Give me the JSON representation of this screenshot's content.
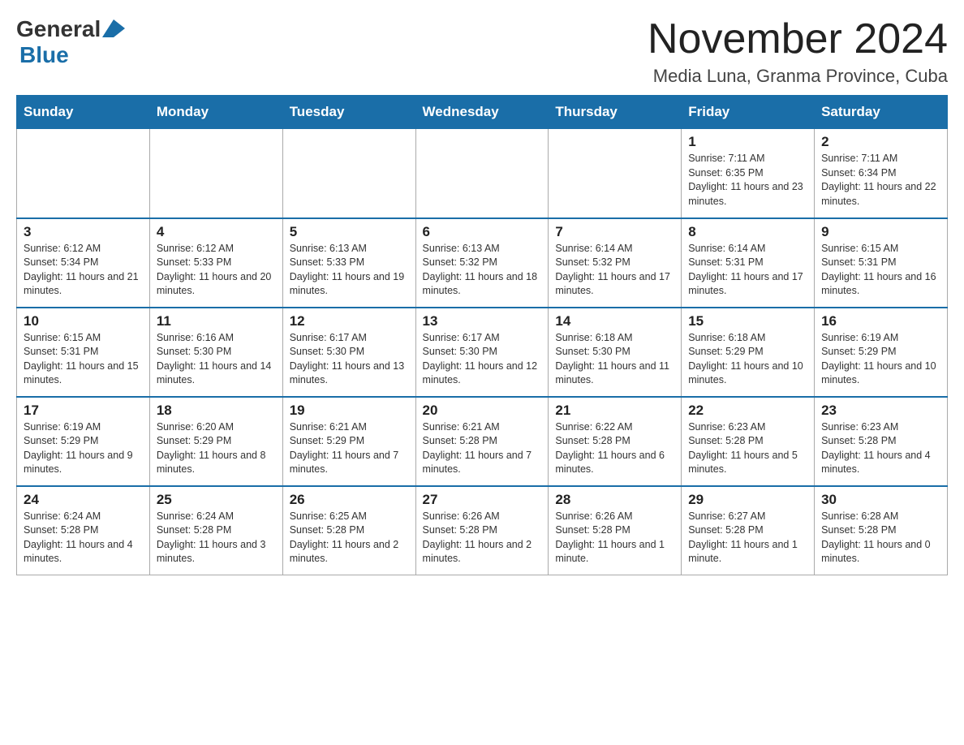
{
  "logo": {
    "general": "General",
    "blue": "Blue"
  },
  "header": {
    "month_title": "November 2024",
    "subtitle": "Media Luna, Granma Province, Cuba"
  },
  "weekdays": [
    "Sunday",
    "Monday",
    "Tuesday",
    "Wednesday",
    "Thursday",
    "Friday",
    "Saturday"
  ],
  "weeks": [
    [
      {
        "day": "",
        "info": ""
      },
      {
        "day": "",
        "info": ""
      },
      {
        "day": "",
        "info": ""
      },
      {
        "day": "",
        "info": ""
      },
      {
        "day": "",
        "info": ""
      },
      {
        "day": "1",
        "info": "Sunrise: 7:11 AM\nSunset: 6:35 PM\nDaylight: 11 hours and 23 minutes."
      },
      {
        "day": "2",
        "info": "Sunrise: 7:11 AM\nSunset: 6:34 PM\nDaylight: 11 hours and 22 minutes."
      }
    ],
    [
      {
        "day": "3",
        "info": "Sunrise: 6:12 AM\nSunset: 5:34 PM\nDaylight: 11 hours and 21 minutes."
      },
      {
        "day": "4",
        "info": "Sunrise: 6:12 AM\nSunset: 5:33 PM\nDaylight: 11 hours and 20 minutes."
      },
      {
        "day": "5",
        "info": "Sunrise: 6:13 AM\nSunset: 5:33 PM\nDaylight: 11 hours and 19 minutes."
      },
      {
        "day": "6",
        "info": "Sunrise: 6:13 AM\nSunset: 5:32 PM\nDaylight: 11 hours and 18 minutes."
      },
      {
        "day": "7",
        "info": "Sunrise: 6:14 AM\nSunset: 5:32 PM\nDaylight: 11 hours and 17 minutes."
      },
      {
        "day": "8",
        "info": "Sunrise: 6:14 AM\nSunset: 5:31 PM\nDaylight: 11 hours and 17 minutes."
      },
      {
        "day": "9",
        "info": "Sunrise: 6:15 AM\nSunset: 5:31 PM\nDaylight: 11 hours and 16 minutes."
      }
    ],
    [
      {
        "day": "10",
        "info": "Sunrise: 6:15 AM\nSunset: 5:31 PM\nDaylight: 11 hours and 15 minutes."
      },
      {
        "day": "11",
        "info": "Sunrise: 6:16 AM\nSunset: 5:30 PM\nDaylight: 11 hours and 14 minutes."
      },
      {
        "day": "12",
        "info": "Sunrise: 6:17 AM\nSunset: 5:30 PM\nDaylight: 11 hours and 13 minutes."
      },
      {
        "day": "13",
        "info": "Sunrise: 6:17 AM\nSunset: 5:30 PM\nDaylight: 11 hours and 12 minutes."
      },
      {
        "day": "14",
        "info": "Sunrise: 6:18 AM\nSunset: 5:30 PM\nDaylight: 11 hours and 11 minutes."
      },
      {
        "day": "15",
        "info": "Sunrise: 6:18 AM\nSunset: 5:29 PM\nDaylight: 11 hours and 10 minutes."
      },
      {
        "day": "16",
        "info": "Sunrise: 6:19 AM\nSunset: 5:29 PM\nDaylight: 11 hours and 10 minutes."
      }
    ],
    [
      {
        "day": "17",
        "info": "Sunrise: 6:19 AM\nSunset: 5:29 PM\nDaylight: 11 hours and 9 minutes."
      },
      {
        "day": "18",
        "info": "Sunrise: 6:20 AM\nSunset: 5:29 PM\nDaylight: 11 hours and 8 minutes."
      },
      {
        "day": "19",
        "info": "Sunrise: 6:21 AM\nSunset: 5:29 PM\nDaylight: 11 hours and 7 minutes."
      },
      {
        "day": "20",
        "info": "Sunrise: 6:21 AM\nSunset: 5:28 PM\nDaylight: 11 hours and 7 minutes."
      },
      {
        "day": "21",
        "info": "Sunrise: 6:22 AM\nSunset: 5:28 PM\nDaylight: 11 hours and 6 minutes."
      },
      {
        "day": "22",
        "info": "Sunrise: 6:23 AM\nSunset: 5:28 PM\nDaylight: 11 hours and 5 minutes."
      },
      {
        "day": "23",
        "info": "Sunrise: 6:23 AM\nSunset: 5:28 PM\nDaylight: 11 hours and 4 minutes."
      }
    ],
    [
      {
        "day": "24",
        "info": "Sunrise: 6:24 AM\nSunset: 5:28 PM\nDaylight: 11 hours and 4 minutes."
      },
      {
        "day": "25",
        "info": "Sunrise: 6:24 AM\nSunset: 5:28 PM\nDaylight: 11 hours and 3 minutes."
      },
      {
        "day": "26",
        "info": "Sunrise: 6:25 AM\nSunset: 5:28 PM\nDaylight: 11 hours and 2 minutes."
      },
      {
        "day": "27",
        "info": "Sunrise: 6:26 AM\nSunset: 5:28 PM\nDaylight: 11 hours and 2 minutes."
      },
      {
        "day": "28",
        "info": "Sunrise: 6:26 AM\nSunset: 5:28 PM\nDaylight: 11 hours and 1 minute."
      },
      {
        "day": "29",
        "info": "Sunrise: 6:27 AM\nSunset: 5:28 PM\nDaylight: 11 hours and 1 minute."
      },
      {
        "day": "30",
        "info": "Sunrise: 6:28 AM\nSunset: 5:28 PM\nDaylight: 11 hours and 0 minutes."
      }
    ]
  ]
}
